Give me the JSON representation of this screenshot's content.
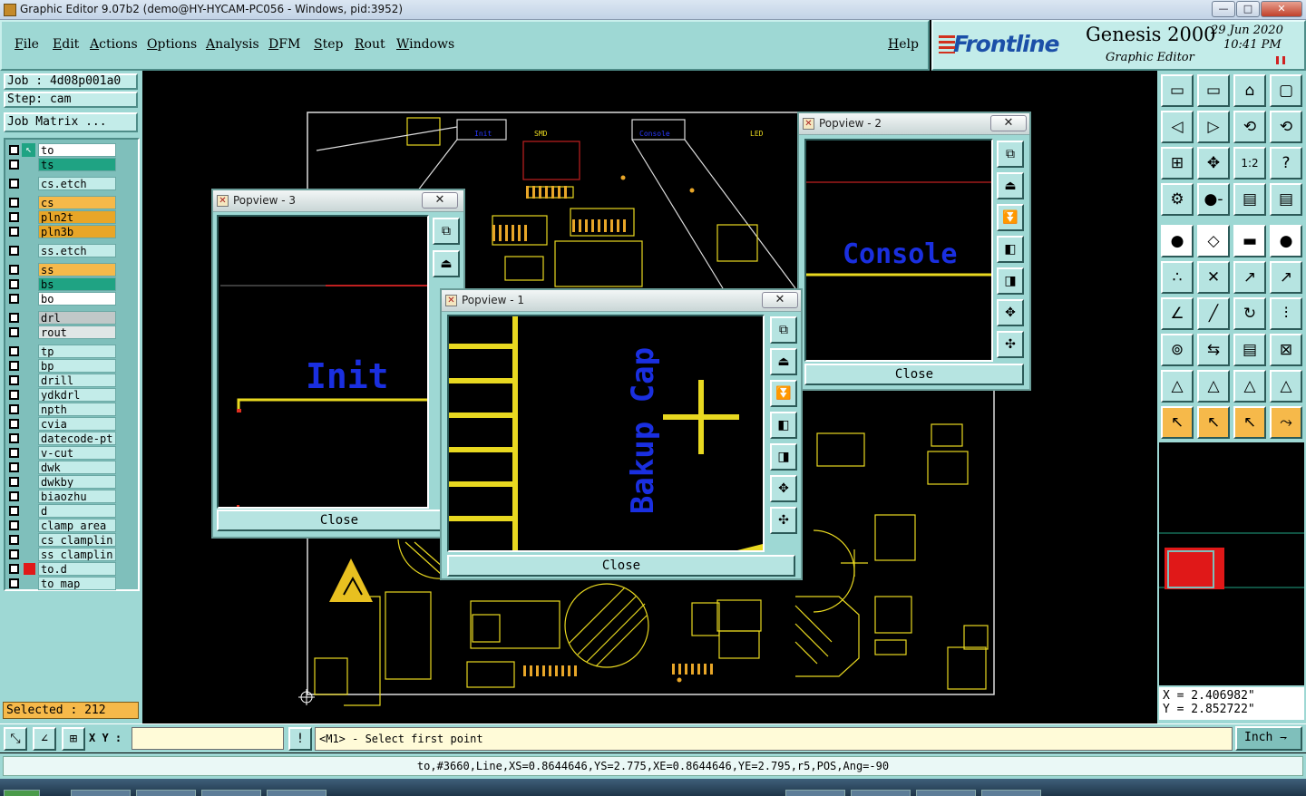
{
  "window": {
    "title": "Graphic Editor 9.07b2 (demo@HY-HYCAM-PC056 - Windows, pid:3952)",
    "min_label": "—",
    "max_label": "□",
    "close_label": "✕"
  },
  "menu": {
    "items": [
      "File",
      "Edit",
      "Actions",
      "Options",
      "Analysis",
      "DFM",
      "Step",
      "Rout",
      "Windows"
    ],
    "help": "Help"
  },
  "brand": {
    "logo": "Frontline",
    "product": "Genesis 2000",
    "subtitle": "Graphic Editor",
    "date": "29 Jun 2020",
    "time": "10:41 PM"
  },
  "left": {
    "job": "Job : 4d08p001a0",
    "step": "Step: cam",
    "job_matrix": "Job Matrix ...",
    "selected": "Selected : 212",
    "layers": [
      {
        "name": "to",
        "color": "#ffffff"
      },
      {
        "name": "ts",
        "color": "#1fa383"
      },
      {
        "name": "cs.etch",
        "color": "#c3ece9"
      },
      {
        "name": "cs",
        "color": "#f6b94a"
      },
      {
        "name": "pln2t",
        "color": "#e8a628"
      },
      {
        "name": "pln3b",
        "color": "#e8a628"
      },
      {
        "name": "ss.etch",
        "color": "#c3ece9"
      },
      {
        "name": "ss",
        "color": "#f6b94a"
      },
      {
        "name": "bs",
        "color": "#1fa383"
      },
      {
        "name": "bo",
        "color": "#ffffff"
      },
      {
        "name": "drl",
        "color": "#c0c8c8"
      },
      {
        "name": "rout",
        "color": "#e0e6e6"
      },
      {
        "name": "tp",
        "color": "#c3ece9"
      },
      {
        "name": "bp",
        "color": "#c3ece9"
      },
      {
        "name": "drill",
        "color": "#c3ece9"
      },
      {
        "name": "ydkdrl",
        "color": "#c3ece9"
      },
      {
        "name": "npth",
        "color": "#c3ece9"
      },
      {
        "name": "cvia",
        "color": "#c3ece9"
      },
      {
        "name": "datecode-pt",
        "color": "#c3ece9"
      },
      {
        "name": "v-cut",
        "color": "#c3ece9"
      },
      {
        "name": "dwk",
        "color": "#c3ece9"
      },
      {
        "name": "dwkby",
        "color": "#c3ece9"
      },
      {
        "name": "biaozhu",
        "color": "#c3ece9"
      },
      {
        "name": "d",
        "color": "#c3ece9"
      },
      {
        "name": "clamp_area",
        "color": "#c3ece9"
      },
      {
        "name": "cs_clamplin",
        "color": "#c3ece9"
      },
      {
        "name": "ss_clamplin",
        "color": "#c3ece9"
      },
      {
        "name": "to.d",
        "color": "#c3ece9"
      },
      {
        "name": "to_map",
        "color": "#c3ece9"
      }
    ]
  },
  "popviews": {
    "p1": {
      "title": "Popview - 1",
      "label": "Bakup Cap",
      "close": "Close"
    },
    "p2": {
      "title": "Popview - 2",
      "label": "Console",
      "close": "Close"
    },
    "p3": {
      "title": "Popview - 3",
      "label": "Init",
      "close": "Close"
    },
    "close_x": "✕"
  },
  "board_labels": {
    "init": "Init",
    "console": "Console",
    "smd": "SMD",
    "led": "LED"
  },
  "coords": {
    "x": "X = 2.406982\"",
    "y": "Y = 2.852722\""
  },
  "bottom": {
    "xy_label": "X Y :",
    "xy_value": "",
    "prompt": "<M1> - Select first point",
    "unit": "Inch",
    "status": "to,#3660,Line,XS=0.8644646,YS=2.775,XE=0.8644646,YE=2.795,r5,POS,Ang=-90"
  },
  "icons": {
    "grid": [
      "zoom-in-icon",
      "zoom-out-icon",
      "home-icon",
      "window-icon",
      "pan-left-icon",
      "pan-right-icon",
      "zoom-1-0-icon",
      "fit-icon",
      "move-icon",
      "center-icon",
      "scale-1-2-icon",
      "help-icon",
      "snap-icon",
      "measure-icon",
      "layers-icon",
      "traffic-icon",
      "pad-icon",
      "shape-icon",
      "stripe-icon",
      "circle-icon",
      "add-node-icon",
      "cut-icon",
      "add-line-icon",
      "arc-icon",
      "angle-icon",
      "line-icon",
      "rotate-icon",
      "split-icon",
      "move-feature-icon",
      "mirror-icon",
      "measure-grid-icon",
      "cross-icon",
      "triangle-icon",
      "triangle-select-icon",
      "triangle-lock-icon",
      "triangle-edit-icon",
      "select-icon",
      "select-box-icon",
      "select-point-icon",
      "select-net-icon"
    ],
    "grid_glyphs": [
      "▭",
      "▭",
      "⌂",
      "▢",
      "◁",
      "▷",
      "⟲",
      "⟲",
      "⊞",
      "✥",
      "1:2",
      "?",
      "⚙",
      "●-",
      "▤",
      "▤",
      "●",
      "◇",
      "▬",
      "●",
      "∴",
      "✕",
      "↗",
      "↗",
      "∠",
      "╱",
      "↻",
      "⫶",
      "⊚",
      "⇆",
      "▤",
      "⊠",
      "△",
      "△",
      "△",
      "△",
      "↖",
      "↖",
      "↖",
      "⤳"
    ]
  }
}
